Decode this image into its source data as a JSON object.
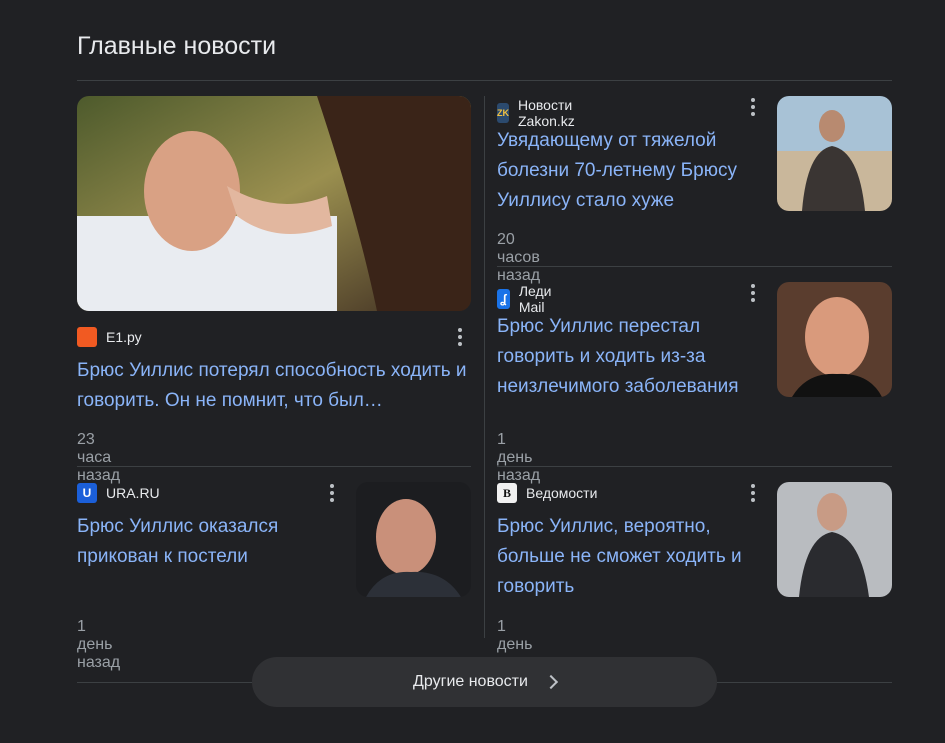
{
  "section": {
    "title": "Главные новости"
  },
  "articles": [
    {
      "source": "E1.ру",
      "source_icon": "e1-logo-icon",
      "title": "Брюс Уиллис потерял способность ходить и говорить. Он не помнит, что был…",
      "time": "23 часа назад"
    },
    {
      "source": "Новости Zakon.kz",
      "source_icon": "zakon-kz-logo-icon",
      "title": "Увядающему от тяжелой болезни 70-летнему Брюсу Уиллису стало хуже",
      "time": "20 часов назад"
    },
    {
      "source": "Леди Mail",
      "source_icon": "lady-mail-logo-icon",
      "title": "Брюс Уиллис перестал говорить и ходить из-за неизлечимого заболевания",
      "time": "1 день назад"
    },
    {
      "source": "URA.RU",
      "source_icon": "ura-ru-logo-icon",
      "title": "Брюс Уиллис оказался прикован к постели",
      "time": "1 день назад"
    },
    {
      "source": "Ведомости",
      "source_icon": "vedomosti-logo-icon",
      "title": "Брюс Уиллис, вероятно, больше не сможет ходить и говорить",
      "time": "1 день назад"
    }
  ],
  "more_button": {
    "label": "Другие новости"
  },
  "colors": {
    "background": "#202124",
    "link": "#8ab4f8",
    "muted": "#9aa0a6",
    "divider": "#3c4043"
  }
}
